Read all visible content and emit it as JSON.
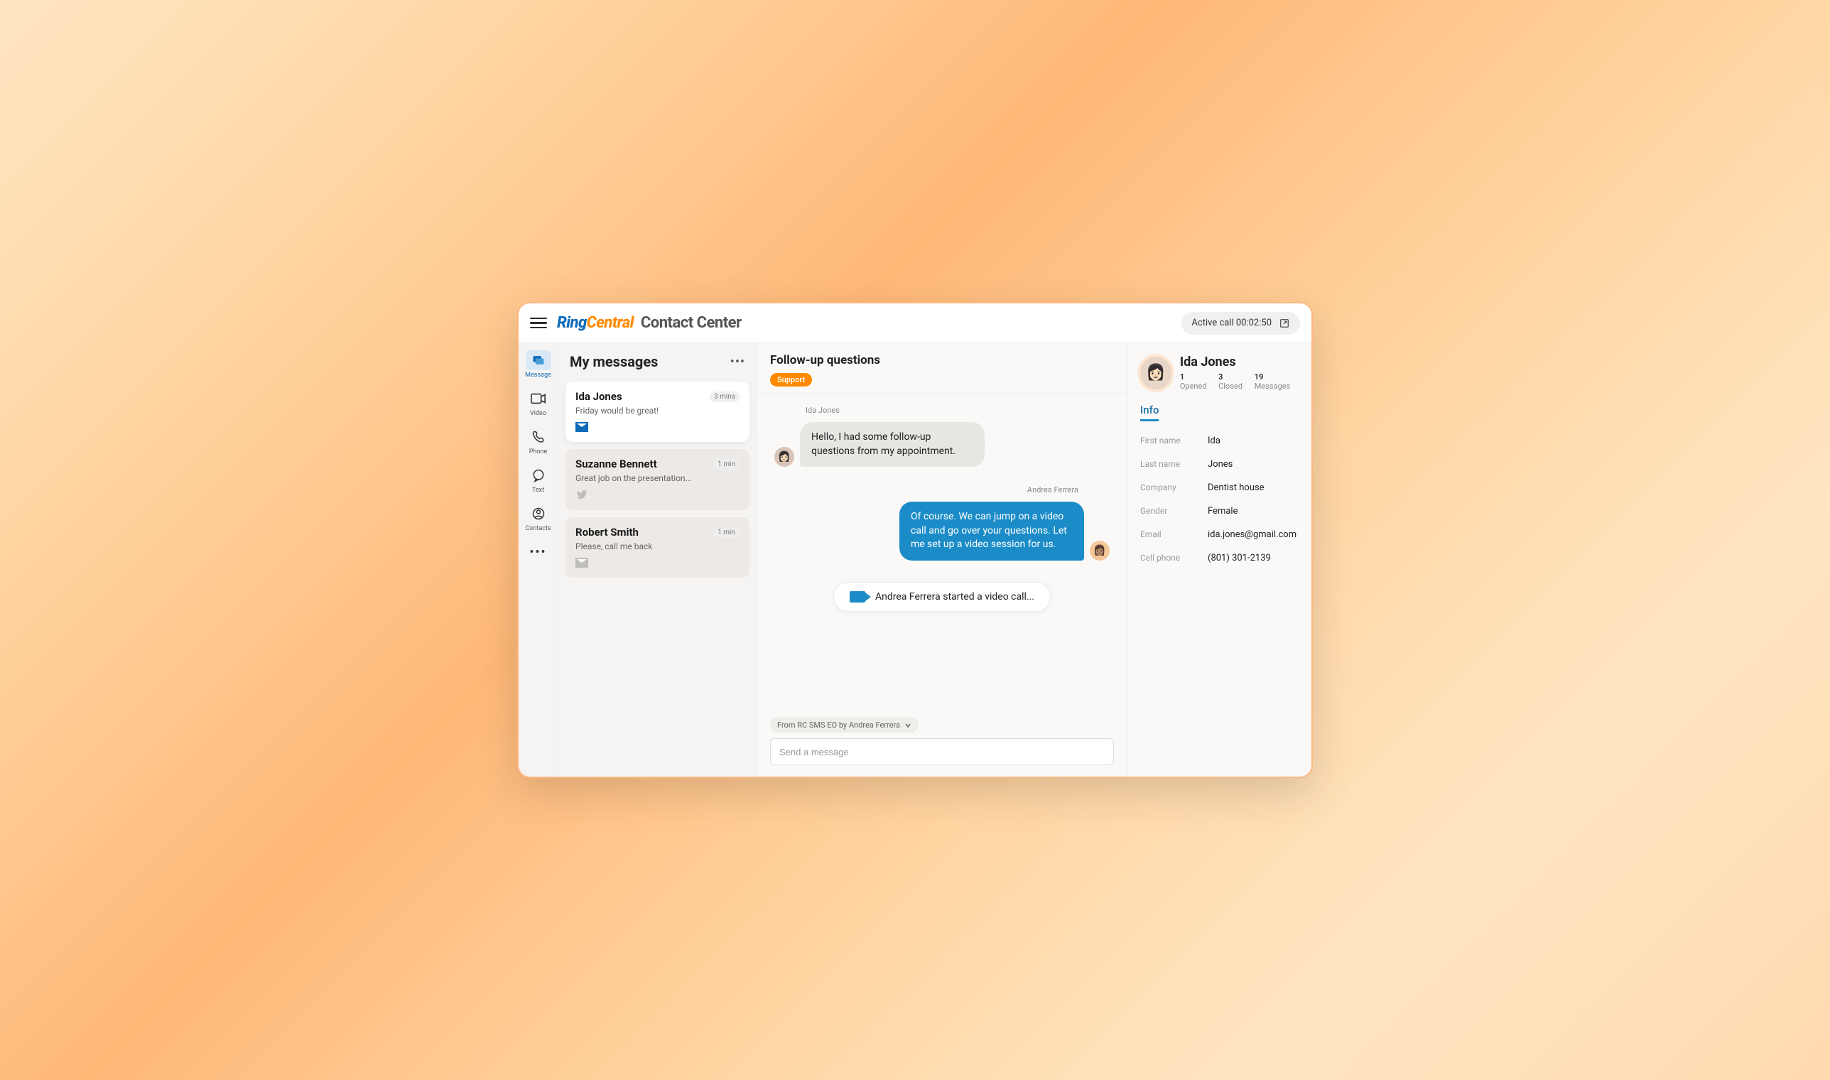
{
  "header": {
    "brand_ring": "Ring",
    "brand_central": "Central",
    "brand_cc": "Contact Center",
    "active_call_label": "Active call 00:02:50"
  },
  "rail": {
    "message": "Message",
    "video": "Video",
    "phone": "Phone",
    "text": "Text",
    "contacts": "Contacts"
  },
  "messages": {
    "title": "My messages",
    "items": [
      {
        "name": "Ida Jones",
        "time": "3 mins",
        "preview": "Friday would be great!"
      },
      {
        "name": "Suzanne Bennett",
        "time": "1 min",
        "preview": "Great job on the presentation..."
      },
      {
        "name": "Robert Smith",
        "time": "1 min",
        "preview": "Please, call me back"
      }
    ]
  },
  "conversation": {
    "title": "Follow-up questions",
    "tag": "Support",
    "sender_a": "Ida Jones",
    "bubble_a": "Hello, I had some follow-up questions  from my appointment.",
    "sender_b": "Andrea Ferrera",
    "bubble_b": "Of course. We can jump on a video call and go over your questions. Let me set up a video session for us.",
    "video_event": "Andrea Ferrera started a video call...",
    "from_chip": "From RC SMS EO by Andrea Ferrera",
    "compose_placeholder": "Send a message"
  },
  "info": {
    "name": "Ida Jones",
    "stats": {
      "opened": "1",
      "opened_label": "Opened",
      "closed": "3",
      "closed_label": "Closed",
      "messages": "19",
      "messages_label": "Messages"
    },
    "tab": "Info",
    "fields": {
      "first_name_label": "First name",
      "first_name": "Ida",
      "last_name_label": "Last name",
      "last_name": "Jones",
      "company_label": "Company",
      "company": "Dentist house",
      "gender_label": "Gender",
      "gender": "Female",
      "email_label": "Email",
      "email": "ida.jones@gmail.com",
      "cell_label": "Cell phone",
      "cell": "(801) 301-2139"
    }
  }
}
